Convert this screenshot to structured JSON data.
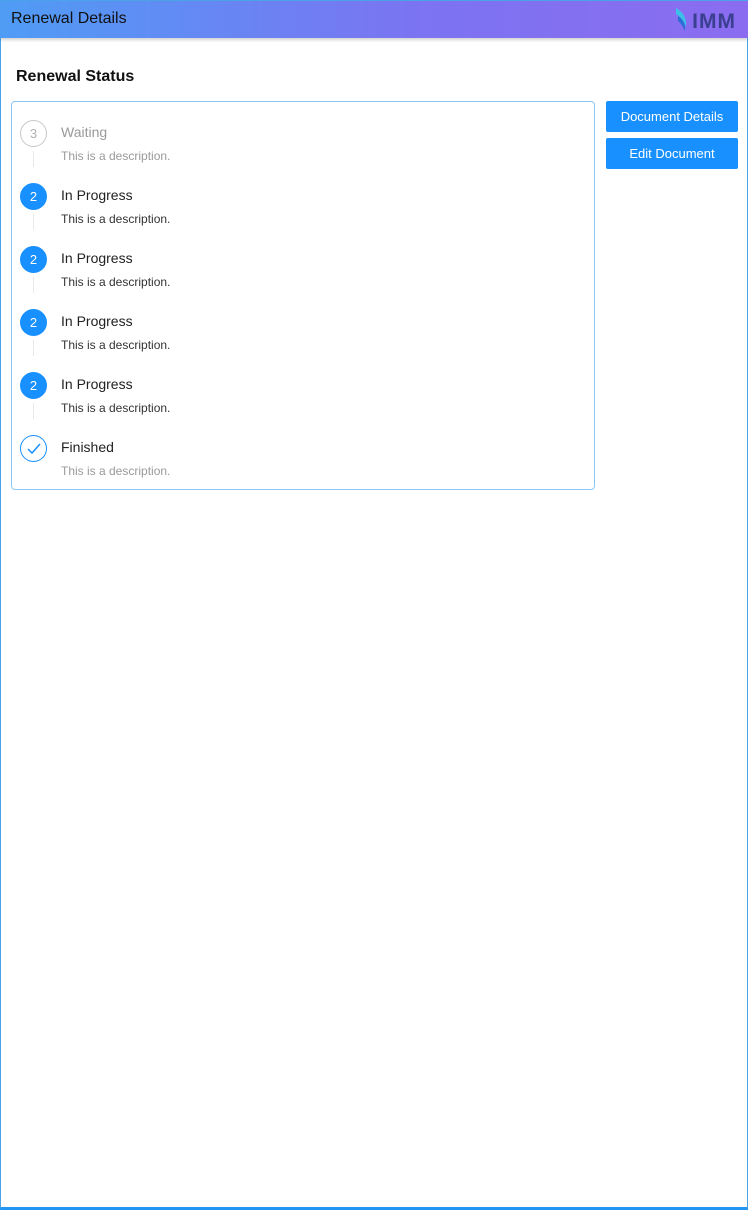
{
  "header": {
    "title": "Renewal Details",
    "logo_text": "IMM",
    "logo_icon": "leaf-mark-icon",
    "gradient_start": "#4f9cf5",
    "gradient_end": "#8b6cf0"
  },
  "main": {
    "section_title": "Renewal Status",
    "steps": [
      {
        "status": "wait",
        "icon_text": "3",
        "title": "Waiting",
        "description": "This is a description."
      },
      {
        "status": "process",
        "icon_text": "2",
        "title": "In Progress",
        "description": "This is a description."
      },
      {
        "status": "process",
        "icon_text": "2",
        "title": "In Progress",
        "description": "This is a description."
      },
      {
        "status": "process",
        "icon_text": "2",
        "title": "In Progress",
        "description": "This is a description."
      },
      {
        "status": "process",
        "icon_text": "2",
        "title": "In Progress",
        "description": "This is a description."
      },
      {
        "status": "finish",
        "icon": "checkmark-icon",
        "title": "Finished",
        "description": "This is a description."
      }
    ]
  },
  "actions": {
    "document_details_label": "Document Details",
    "edit_document_label": "Edit Document",
    "accent_color": "#1890ff"
  }
}
